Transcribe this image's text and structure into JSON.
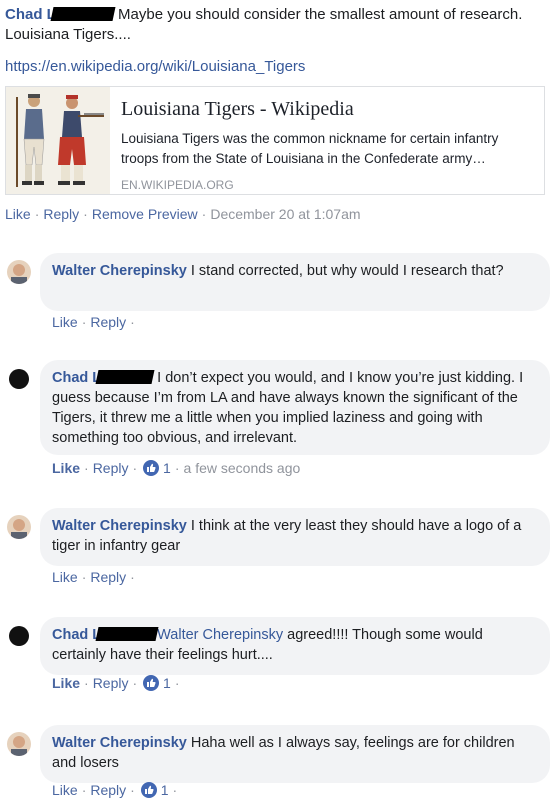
{
  "post_comment": {
    "author": "Chad L",
    "text": "Maybe you should consider the smallest amount of research. Louisiana Tigers....",
    "link": "https://en.wikipedia.org/wiki/Louisiana_Tigers",
    "preview": {
      "title": "Louisiana Tigers - Wikipedia",
      "description": "Louisiana Tigers was the common nickname for certain infantry troops from the State of Louisiana in the Confederate army…",
      "domain": "EN.WIKIPEDIA.ORG"
    },
    "actions": {
      "like": "Like",
      "reply": "Reply",
      "remove_preview": "Remove Preview",
      "timestamp": "December 20 at 1:07am"
    }
  },
  "comments": [
    {
      "author": "Walter Cherepinsky",
      "text": "I stand corrected, but why would I research that?",
      "like": "Like",
      "reply": "Reply"
    },
    {
      "author": "Chad L",
      "text": "I don’t expect you would, and I know you’re just kidding. I guess because I’m from LA and have always known the significant of the Tigers, it threw me a little when you implied laziness and going with something too obvious, and irrelevant.",
      "like": "Like",
      "reply": "Reply",
      "reaction_count": "1",
      "timestamp": "a few seconds ago"
    },
    {
      "author": "Walter Cherepinsky",
      "text": "I think at the very least they should have a logo of a tiger in infantry gear",
      "like": "Like",
      "reply": "Reply"
    },
    {
      "author": "Chad L",
      "mention": "Walter Cherepinsky",
      "text": "agreed!!!! Though some would certainly have their feelings hurt....",
      "like": "Like",
      "reply": "Reply",
      "reaction_count": "1"
    },
    {
      "author": "Walter Cherepinsky",
      "text": "Haha well as I always say, feelings are for children and losers",
      "like": "Like",
      "reply": "Reply",
      "reaction_count": "1"
    }
  ],
  "colors": {
    "link_blue": "#365899",
    "action_blue": "#4b67a1",
    "bubble_gray": "#f2f3f5",
    "meta_gray": "#90949c",
    "like_badge": "#4267b2"
  }
}
